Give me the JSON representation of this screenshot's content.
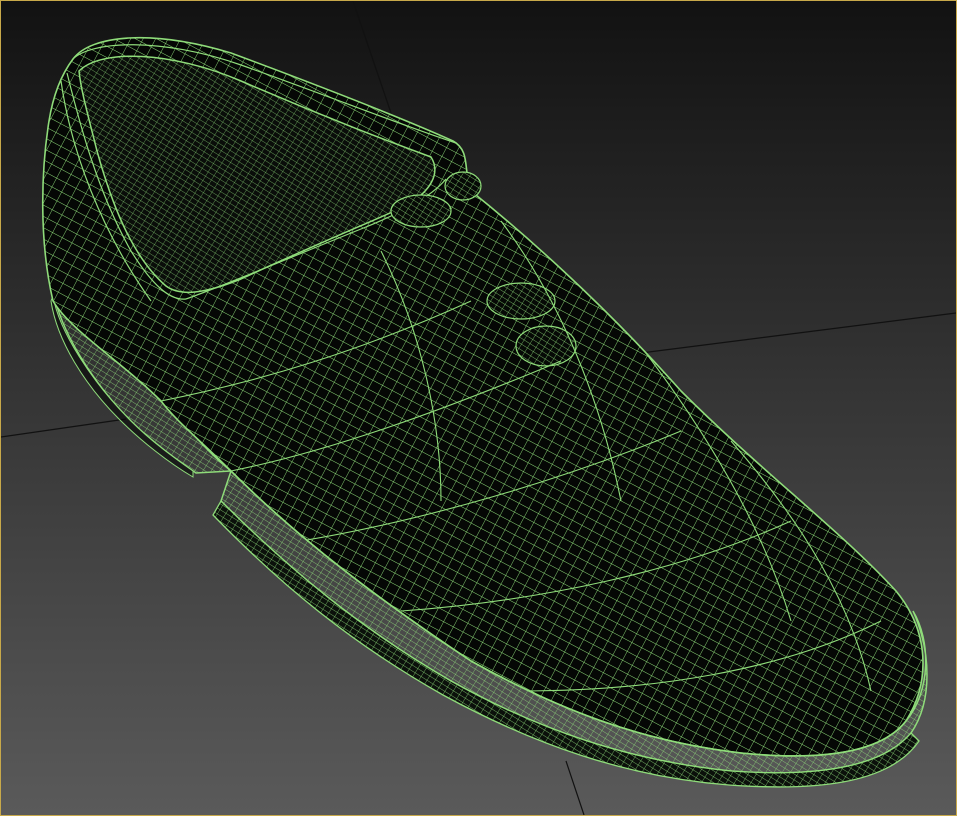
{
  "viewport": {
    "view": "perspective",
    "shading": "wireframe",
    "grid_visible": true,
    "active_border_color": "#c8a94a"
  },
  "colors": {
    "background_top": "#121212",
    "background_bottom": "#5a5a5a",
    "grid_line": "#111111",
    "wire": "#8fdc7a",
    "mesh_fill": "#050705"
  },
  "object": {
    "name": "shoe-mesh",
    "kind": "low-cut leather shoe",
    "display": "wireframe"
  }
}
